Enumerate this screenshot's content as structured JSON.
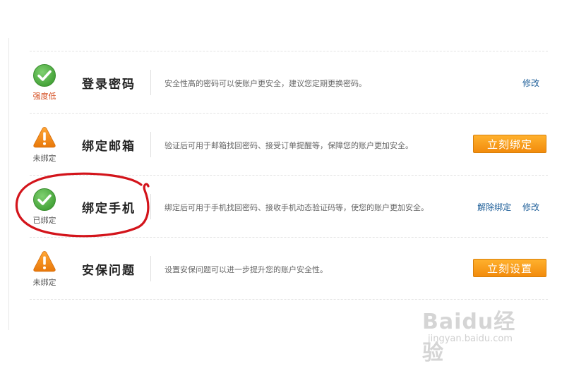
{
  "rows": [
    {
      "status_icon": "check-circle-icon",
      "status_label": "强度低",
      "title": "登录密码",
      "description": "安全性高的密码可以使账户更安全，建议您定期更换密码。",
      "actions": [
        "修改"
      ]
    },
    {
      "status_icon": "warning-triangle-icon",
      "status_label": "未绑定",
      "title": "绑定邮箱",
      "description": "验证后可用于邮箱找回密码、接受订单提醒等，保障您的账户更加安全。",
      "button_label": "立刻绑定"
    },
    {
      "status_icon": "check-circle-icon",
      "status_label": "已绑定",
      "title": "绑定手机",
      "description": "绑定后可用于手机找回密码、接收手机动态验证码等，使您的账户更加安全。",
      "actions": [
        "解除绑定",
        "修改"
      ]
    },
    {
      "status_icon": "warning-triangle-icon",
      "status_label": "未绑定",
      "title": "安保问题",
      "description": "设置安保问题可以进一步提升您的账户安全性。",
      "button_label": "立刻设置"
    }
  ],
  "watermark": {
    "logo_text": "Baidu经验",
    "url_text": "jingyan.baidu.com"
  },
  "colors": {
    "check": "#55b447",
    "warning": "#f28a10",
    "button": "#f5960f",
    "link": "#1f5f99",
    "annotation": "#d3141b"
  }
}
